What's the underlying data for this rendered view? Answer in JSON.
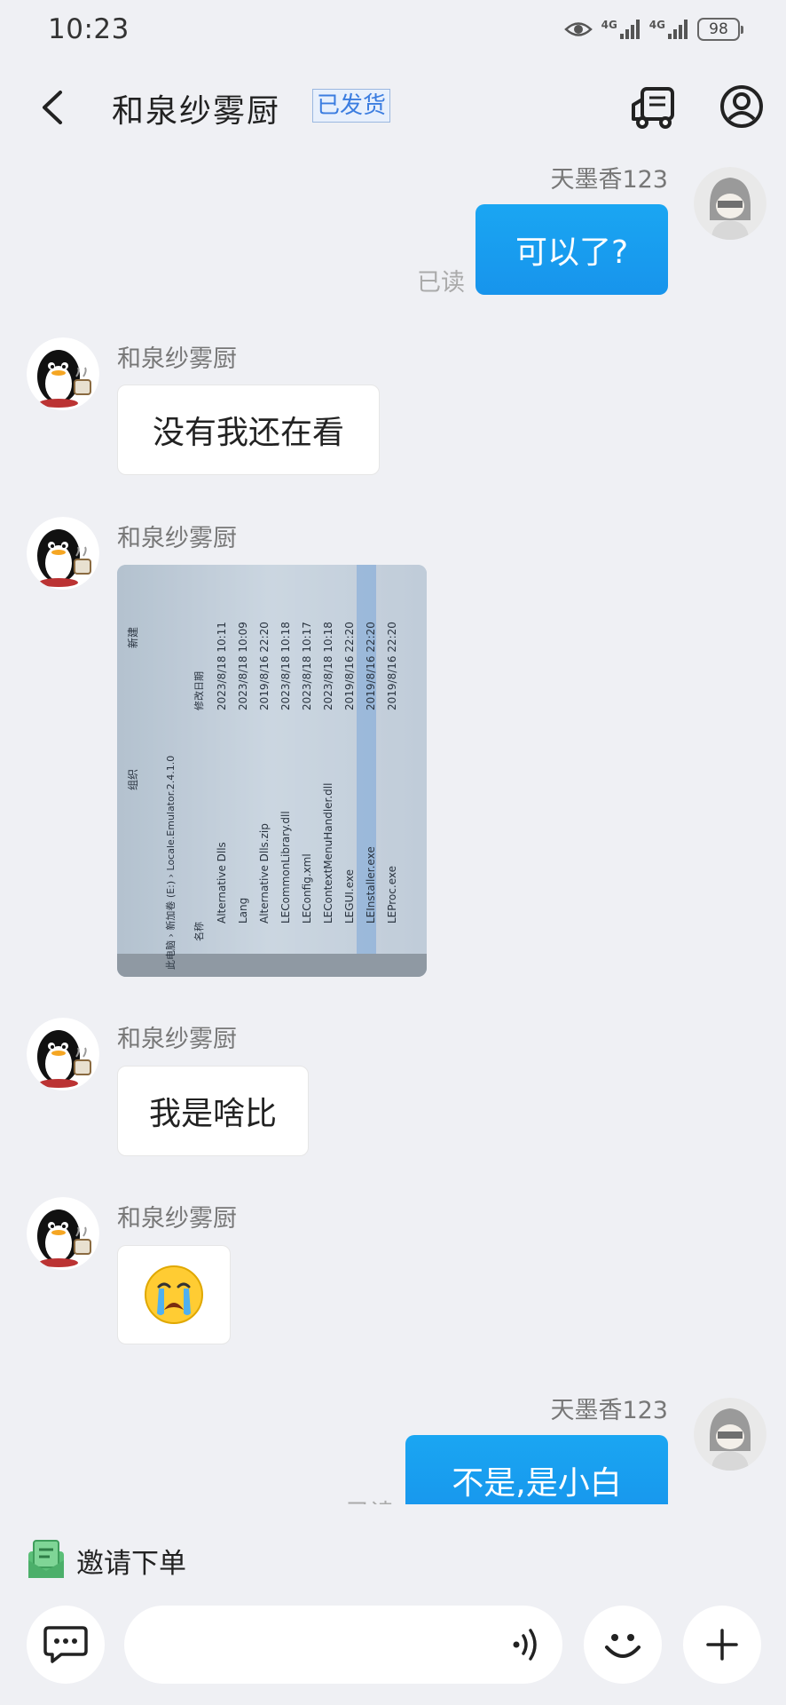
{
  "status_bar": {
    "time": "10:23",
    "battery": "98",
    "network_1": "4G",
    "network_2": "4G"
  },
  "header": {
    "title": "和泉纱雾厨",
    "badge": "已发货",
    "icons": [
      "back-arrow-icon",
      "delivery-truck-icon",
      "profile-icon"
    ]
  },
  "messages": [
    {
      "direction": "out",
      "sender": "天墨香123",
      "text": "可以了?",
      "status": "已读"
    },
    {
      "direction": "in",
      "sender": "和泉纱雾厨",
      "text": "没有我还在看"
    },
    {
      "direction": "in",
      "sender": "和泉纱雾厨",
      "type": "image",
      "image": {
        "breadcrumb": "此电脑 › 新加卷 (E:) › Locale.Emulator.2.4.1.0",
        "toolbar_left": "组织",
        "toolbar_right": "新建",
        "col_name": "名称",
        "col_date": "修改日期",
        "files": [
          {
            "name": "Alternative Dlls",
            "date": "2023/8/18 10:11"
          },
          {
            "name": "Lang",
            "date": "2023/8/18 10:09"
          },
          {
            "name": "Alternative Dlls.zip",
            "date": "2019/8/16 22:20"
          },
          {
            "name": "LECommonLibrary.dll",
            "date": "2023/8/18 10:18"
          },
          {
            "name": "LEConfig.xml",
            "date": "2023/8/18 10:17"
          },
          {
            "name": "LEContextMenuHandler.dll",
            "date": "2023/8/18 10:18"
          },
          {
            "name": "LEGUI.exe",
            "date": "2019/8/16 22:20"
          },
          {
            "name": "LEInstaller.exe",
            "date": "2019/8/16 22:20"
          },
          {
            "name": "LEProc.exe",
            "date": "2019/8/16 22:20"
          }
        ]
      }
    },
    {
      "direction": "in",
      "sender": "和泉纱雾厨",
      "text": "我是啥比"
    },
    {
      "direction": "in",
      "sender": "和泉纱雾厨",
      "type": "emoji",
      "text": "😭"
    },
    {
      "direction": "out",
      "sender": "天墨香123",
      "text": "不是,是小白",
      "status": "已读"
    }
  ],
  "bottom": {
    "invite_label": "邀请下单",
    "icons": [
      "order-invite-icon",
      "chat-bubble-icon",
      "voice-icon",
      "emoji-face-icon",
      "plus-icon"
    ]
  },
  "colors": {
    "background": "#eff0f4",
    "outgoing_bubble": "#1794ec",
    "badge_text": "#3b7de0"
  }
}
